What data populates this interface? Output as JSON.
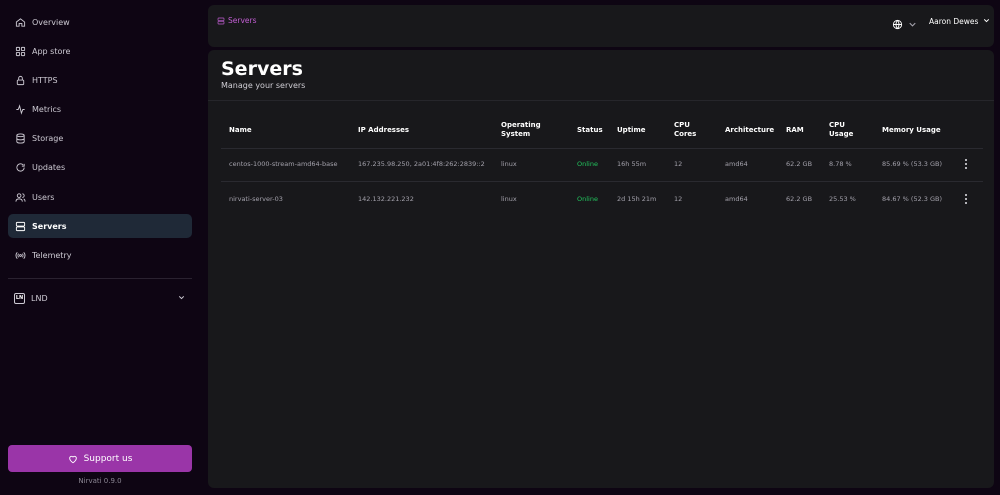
{
  "sidebar": {
    "items": [
      {
        "label": "Overview",
        "icon": "home-icon"
      },
      {
        "label": "App store",
        "icon": "grid-icon"
      },
      {
        "label": "HTTPS",
        "icon": "lock-icon"
      },
      {
        "label": "Metrics",
        "icon": "activity-icon"
      },
      {
        "label": "Storage",
        "icon": "database-icon"
      },
      {
        "label": "Updates",
        "icon": "refresh-icon"
      },
      {
        "label": "Users",
        "icon": "users-icon"
      },
      {
        "label": "Servers",
        "icon": "server-icon",
        "active": true
      },
      {
        "label": "Telemetry",
        "icon": "broadcast-icon"
      }
    ],
    "app": {
      "badge": "LN",
      "label": "LND"
    },
    "support_label": "Support us",
    "version": "Nirvati 0.9.0"
  },
  "topbar": {
    "breadcrumb": "Servers",
    "user_name": "Aaron Dewes"
  },
  "page": {
    "title": "Servers",
    "subtitle": "Manage your servers"
  },
  "table": {
    "headers": {
      "name": "Name",
      "ip": "IP Addresses",
      "os_1": "Operating",
      "os_2": "System",
      "status": "Status",
      "uptime": "Uptime",
      "cores_1": "CPU",
      "cores_2": "Cores",
      "arch": "Architecture",
      "ram": "RAM",
      "cpu_1": "CPU",
      "cpu_2": "Usage",
      "mem": "Memory Usage"
    },
    "rows": [
      {
        "name": "centos-1000-stream-amd64-base",
        "ip": "167.235.98.250, 2a01:4f8:262:2839::2",
        "os": "linux",
        "status": "Online",
        "uptime": "16h 55m",
        "cores": "12",
        "arch": "amd64",
        "ram": "62.2 GB",
        "cpu": "8.78 %",
        "mem": "85.69 % (53.3 GB)"
      },
      {
        "name": "nirvati-server-03",
        "ip": "142.132.221.232",
        "os": "linux",
        "status": "Online",
        "uptime": "2d 15h 21m",
        "cores": "12",
        "arch": "amd64",
        "ram": "62.2 GB",
        "cpu": "25.53 %",
        "mem": "84.67 % (52.3 GB)"
      }
    ]
  },
  "colors": {
    "accent": "#9a35a8",
    "breadcrumb": "#c25ed4",
    "online": "#22c55e",
    "active_nav": "#1f2937"
  }
}
